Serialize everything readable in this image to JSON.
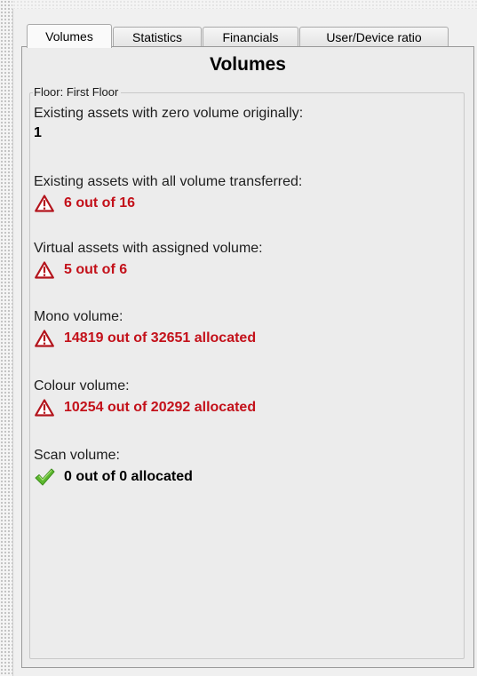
{
  "tabs": [
    {
      "label": "Volumes",
      "active": true
    },
    {
      "label": "Statistics",
      "active": false
    },
    {
      "label": "Financials",
      "active": false
    },
    {
      "label": "User/Device ratio",
      "active": false
    }
  ],
  "panel": {
    "title": "Volumes",
    "group_legend": "Floor: First Floor",
    "items": [
      {
        "label": "Existing assets with zero volume originally:",
        "value": "1",
        "status": "none"
      },
      {
        "label": "Existing assets with all volume transferred:",
        "value": "6 out of 16",
        "status": "warning",
        "icon": "warning-triangle-icon"
      },
      {
        "label": "Virtual assets with assigned volume:",
        "value": "5 out of 6",
        "status": "warning",
        "icon": "warning-triangle-icon"
      },
      {
        "label": "Mono volume:",
        "value": "14819 out of 32651 allocated",
        "status": "warning",
        "icon": "warning-triangle-icon"
      },
      {
        "label": "Colour volume:",
        "value": "10254 out of 20292 allocated",
        "status": "warning",
        "icon": "warning-triangle-icon"
      },
      {
        "label": "Scan volume:",
        "value": "0 out of 0 allocated",
        "status": "ok",
        "icon": "green-checkmark-icon"
      }
    ]
  },
  "colors": {
    "warning_text": "#c3111a",
    "ok_check": "#5cb82e",
    "panel_bg": "#ececec"
  }
}
